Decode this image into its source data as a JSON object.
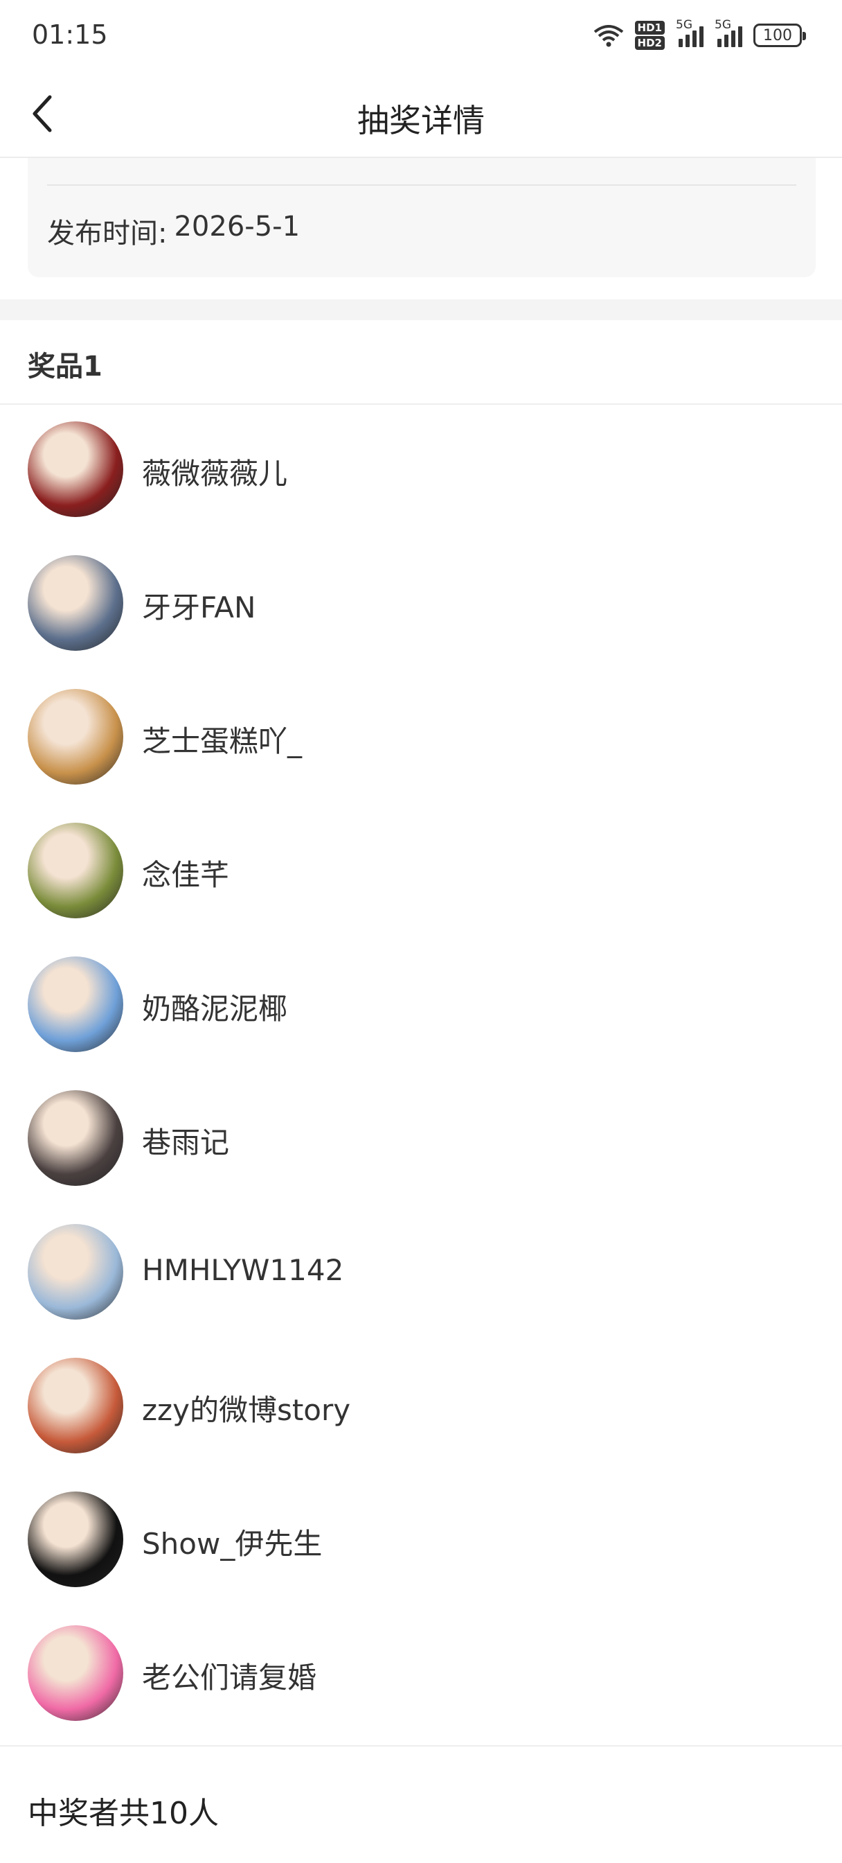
{
  "status_bar": {
    "time": "01:15",
    "hd1": "HD1",
    "hd2": "HD2",
    "signal1_label": "5G",
    "signal2_label": "5G",
    "battery": "100",
    "icons": [
      "wifi-icon",
      "hd-icon",
      "signal-icon",
      "signal-icon",
      "battery-icon"
    ]
  },
  "nav": {
    "title": "抽奖详情",
    "back_icon": "chevron-left-icon"
  },
  "info": {
    "publish_label": "发布时间:",
    "publish_date": "2026-5-1"
  },
  "prize": {
    "title": "奖品1"
  },
  "winners": [
    {
      "name": "薇微薇薇儿",
      "avatar_color": "#8a1f1f"
    },
    {
      "name": "牙牙FAN",
      "avatar_color": "#5c6f8c"
    },
    {
      "name": "芝士蛋糕吖_",
      "avatar_color": "#c8914b"
    },
    {
      "name": "念佳芊",
      "avatar_color": "#7a8c3a"
    },
    {
      "name": "奶酪泥泥椰",
      "avatar_color": "#6fa0d8"
    },
    {
      "name": "巷雨记",
      "avatar_color": "#4a4040"
    },
    {
      "name": "HMHLYW1142",
      "avatar_color": "#9ab8d8"
    },
    {
      "name": "zzy的微博story",
      "avatar_color": "#c65a3a"
    },
    {
      "name": "Show_伊先生",
      "avatar_color": "#111111"
    },
    {
      "name": "老公们请复婚",
      "avatar_color": "#f06aa6"
    }
  ],
  "footer": {
    "total": "中奖者共10人"
  }
}
